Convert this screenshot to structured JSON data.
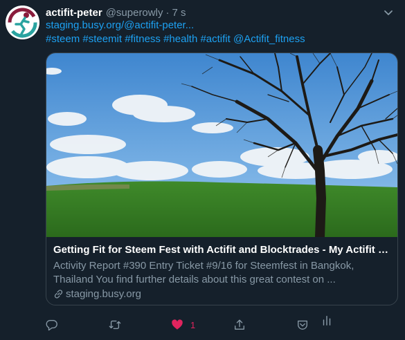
{
  "tweet": {
    "author_name": "actifit-peter",
    "author_handle": "@superowly",
    "separator": "·",
    "timestamp": "7 s",
    "link_text": "staging.busy.org/@actifit-peter...",
    "hashtags_line": "#steem #steemit #fitness #health #actifit @Actifit_fitness",
    "avatar_icon": "actifit-logo-icon",
    "menu_icon": "chevron-down-icon"
  },
  "card": {
    "title": "Getting Fit for Steem Fest with Actifit and Blocktrades - My Actifit Blog: ...",
    "description_line1": "Activity Report #390 Entry Ticket #9/16 for Steemfest in Bangkok,",
    "description_line2": "Thailand You find further details about this great contest on ...",
    "domain": "staging.busy.org",
    "link_icon": "link-icon"
  },
  "actions": {
    "reply_icon": "reply-icon",
    "retweet_icon": "retweet-icon",
    "like_icon": "heart-icon",
    "like_count": "1",
    "share_icon": "share-icon",
    "save_icon": "steem-save-icon",
    "analytics_icon": "analytics-icon"
  },
  "colors": {
    "background": "#15202b",
    "link": "#1da1f2",
    "secondary_text": "#8899a6",
    "like": "#e0245e",
    "border": "#38444d"
  }
}
